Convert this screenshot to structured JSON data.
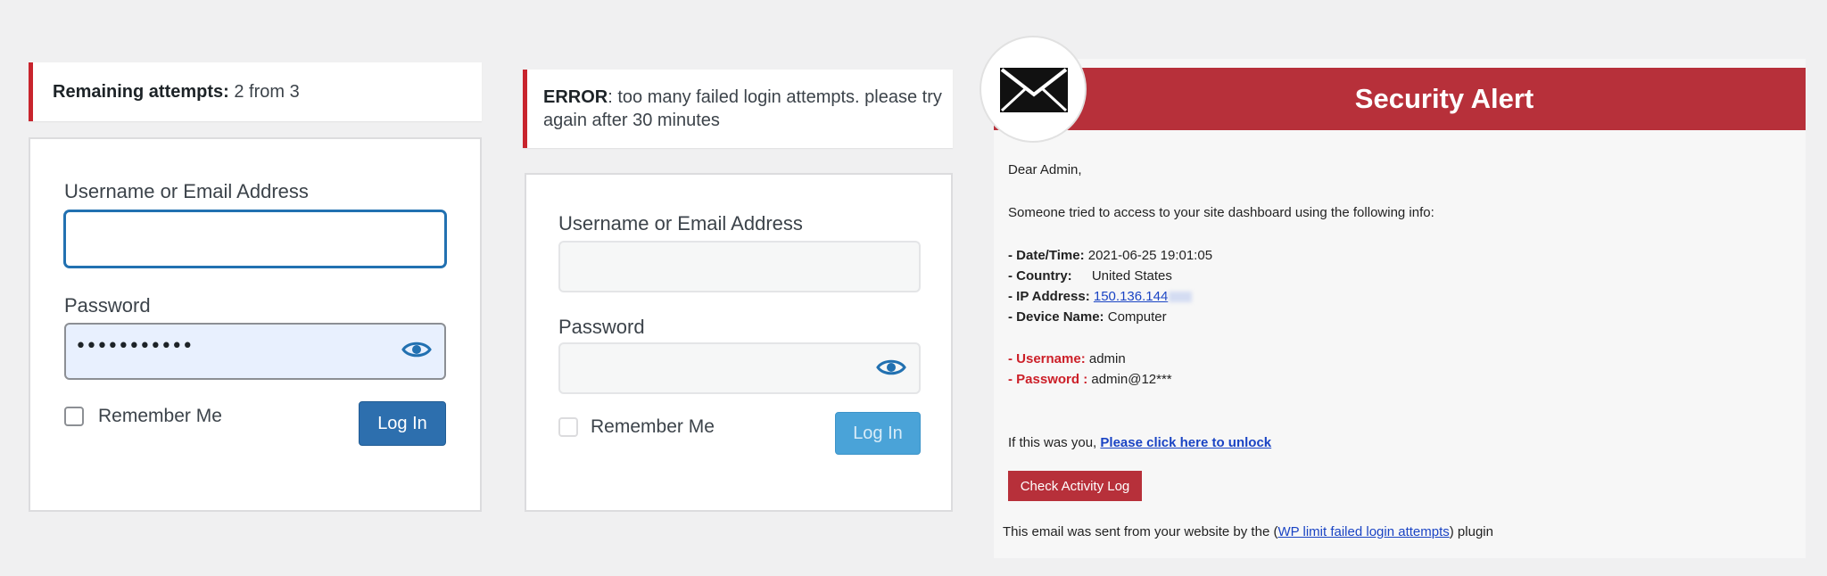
{
  "panel1": {
    "notice_label": "Remaining attempts:",
    "notice_value": "2 from 3",
    "username_label": "Username or Email Address",
    "username_value": "",
    "password_label": "Password",
    "password_masked": "•••••••••••",
    "remember_label": "Remember Me",
    "login_label": "Log In"
  },
  "panel2": {
    "error_label": "ERROR",
    "error_text_line1": ": too many failed login attempts. please try",
    "error_text_line2": "again after 30 minutes",
    "username_label": "Username or Email Address",
    "password_label": "Password",
    "remember_label": "Remember Me",
    "login_label": "Log In"
  },
  "email": {
    "title": "Security Alert",
    "greeting": "Dear Admin,",
    "intro": "Someone tried to access to your site dashboard using the following info:",
    "fields": [
      {
        "label": "- Date/Time:",
        "value": "2021-06-25 19:01:05"
      },
      {
        "label": "- Country:",
        "value": "United States"
      },
      {
        "label": "- IP Address:",
        "value": "150.136.144"
      },
      {
        "label": "- Device Name:",
        "value": "Computer"
      }
    ],
    "credentials": [
      {
        "label": "- Username:",
        "value": "admin"
      },
      {
        "label": "- Password :",
        "value": "admin@12***"
      }
    ],
    "unlock_prefix": "If this was you,",
    "unlock_link": "Please click here to unlock",
    "activity_button": "Check Activity Log",
    "footer_prefix": "This email was sent from your website by the (",
    "footer_link": "WP limit failed login attempts",
    "footer_suffix": ") plugin"
  },
  "icons": [
    "eye-icon",
    "envelope-icon"
  ],
  "colors": {
    "accent_red": "#b7303a",
    "wp_blue": "#2d6fae",
    "error_border": "#c8242d"
  }
}
